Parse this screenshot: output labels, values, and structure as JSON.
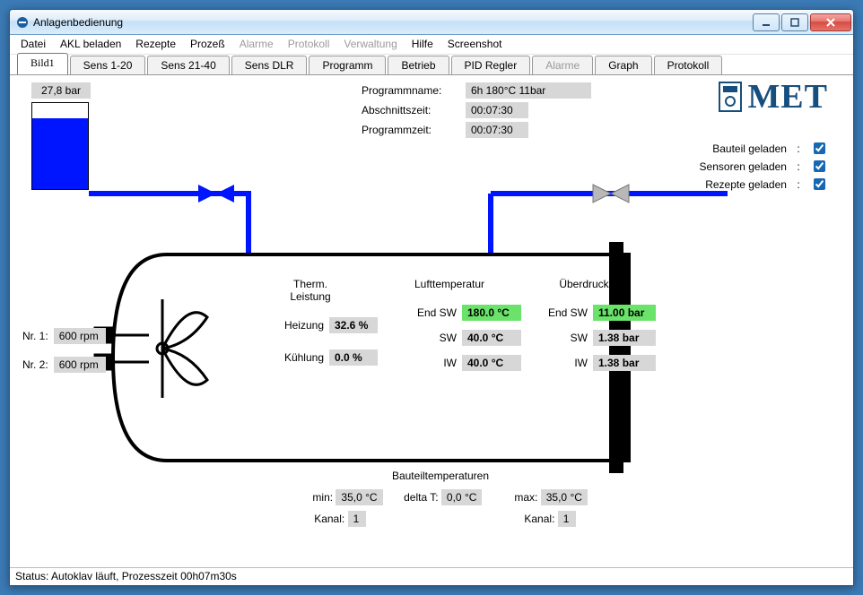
{
  "window": {
    "title": "Anlagenbedienung"
  },
  "menus": {
    "datei": "Datei",
    "akl": "AKL beladen",
    "rezepte": "Rezepte",
    "prozess": "Prozeß",
    "alarme": "Alarme",
    "protokoll": "Protokoll",
    "verwaltung": "Verwaltung",
    "hilfe": "Hilfe",
    "screenshot": "Screenshot"
  },
  "tabs": {
    "bild1": "Bild1",
    "sens1": "Sens 1-20",
    "sens21": "Sens 21-40",
    "sensdlr": "Sens DLR",
    "programm": "Programm",
    "betrieb": "Betrieb",
    "pid": "PID Regler",
    "alarme": "Alarme",
    "graph": "Graph",
    "protokoll": "Protokoll"
  },
  "program": {
    "name_label": "Programmname:",
    "name_value": "6h    180°C    11bar",
    "abschnitt_label": "Abschnittszeit:",
    "abschnitt_value": "00:07:30",
    "zeit_label": "Programmzeit:",
    "zeit_value": "00:07:30"
  },
  "logo_text": "MET",
  "loaded": {
    "bauteil": "Bauteil geladen",
    "sensoren": "Sensoren geladen",
    "rezepte": "Rezepte geladen",
    "sep": ":"
  },
  "tank_pressure": "27,8 bar",
  "rpm": {
    "nr1_label": "Nr. 1:",
    "nr1": "600 rpm",
    "nr2_label": "Nr. 2:",
    "nr2": "600 rpm"
  },
  "therm": {
    "head1": "Therm.",
    "head2": "Leistung",
    "heizung_label": "Heizung",
    "heizung": "32.6 %",
    "kuehlung_label": "Kühlung",
    "kuehlung": "0.0 %"
  },
  "luft": {
    "head": "Lufttemperatur",
    "endsw_label": "End SW",
    "endsw": "180.0 °C",
    "sw_label": "SW",
    "sw": "40.0 °C",
    "iw_label": "IW",
    "iw": "40.0 °C"
  },
  "druck": {
    "head": "Überdruck",
    "endsw_label": "End SW",
    "endsw": "11.00 bar",
    "sw_label": "SW",
    "sw": "1.38 bar",
    "iw_label": "IW",
    "iw": "1.38 bar"
  },
  "bauteil": {
    "head": "Bauteiltemperaturen",
    "min_label": "min:",
    "min": "35,0 °C",
    "delta_label": "delta T:",
    "delta": "0,0 °C",
    "max_label": "max:",
    "max": "35,0 °C",
    "kanal_label": "Kanal:",
    "kanal_min": "1",
    "kanal_max": "1"
  },
  "status": "Status: Autoklav läuft, Prozesszeit 00h07m30s"
}
